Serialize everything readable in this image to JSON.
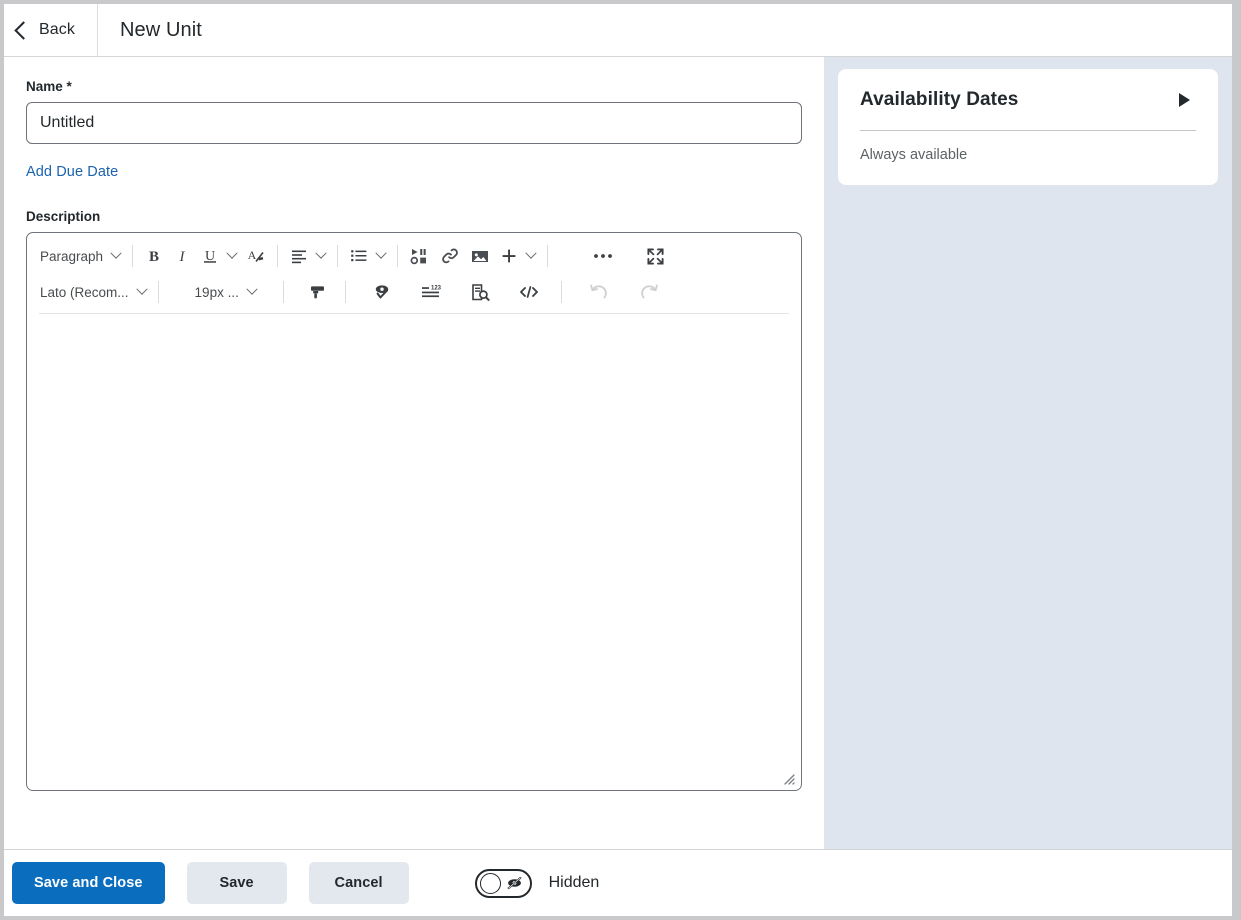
{
  "header": {
    "back_label": "Back",
    "back_icon": "chevron-left-icon",
    "title": "New Unit"
  },
  "form": {
    "name_label": "Name",
    "name_required_marker": "*",
    "name_value": "Untitled",
    "name_placeholder": "Untitled",
    "add_due_date_label": "Add Due Date",
    "description_label": "Description"
  },
  "editor": {
    "toolbar_row1": [
      {
        "name": "paragraph-style-select",
        "label": "Paragraph",
        "icon": "chevron-down-icon",
        "type": "dropdown"
      },
      {
        "name": "bold-button",
        "label": "B",
        "icon": "bold-icon",
        "type": "icon"
      },
      {
        "name": "italic-button",
        "label": "I",
        "icon": "italic-icon",
        "type": "icon"
      },
      {
        "name": "underline-button",
        "label": "U",
        "icon": "underline-icon",
        "type": "icon-dropdown"
      },
      {
        "name": "clear-formatting-button",
        "label": "",
        "icon": "clear-formatting-icon",
        "type": "icon"
      },
      {
        "name": "align-button",
        "label": "",
        "icon": "align-left-icon",
        "type": "icon-dropdown"
      },
      {
        "name": "list-button",
        "label": "",
        "icon": "bulleted-list-icon",
        "type": "icon-dropdown"
      },
      {
        "name": "insert-media-button",
        "label": "",
        "icon": "media-icon",
        "type": "icon"
      },
      {
        "name": "insert-link-button",
        "label": "",
        "icon": "link-icon",
        "type": "icon"
      },
      {
        "name": "insert-image-button",
        "label": "",
        "icon": "image-icon",
        "type": "icon"
      },
      {
        "name": "insert-more-button",
        "label": "",
        "icon": "plus-icon",
        "type": "icon-dropdown"
      },
      {
        "name": "overflow-menu-button",
        "label": "",
        "icon": "ellipsis-icon",
        "type": "icon"
      },
      {
        "name": "fullscreen-button",
        "label": "",
        "icon": "expand-icon",
        "type": "icon"
      }
    ],
    "toolbar_row2": [
      {
        "name": "font-family-select",
        "label": "Lato (Recom...",
        "icon": "chevron-down-icon",
        "type": "dropdown"
      },
      {
        "name": "font-size-select",
        "label": "19px ...",
        "icon": "chevron-down-icon",
        "type": "dropdown"
      },
      {
        "name": "format-painter-button",
        "label": "",
        "icon": "format-painter-icon",
        "type": "icon"
      },
      {
        "name": "accessibility-checker-button",
        "label": "",
        "icon": "accessibility-check-icon",
        "type": "icon"
      },
      {
        "name": "equation-button",
        "label": "",
        "icon": "equation-icon",
        "type": "icon"
      },
      {
        "name": "word-count-button",
        "label": "",
        "icon": "word-count-icon",
        "type": "icon"
      },
      {
        "name": "html-source-button",
        "label": "",
        "icon": "code-icon",
        "type": "icon"
      },
      {
        "name": "undo-button",
        "label": "",
        "icon": "undo-icon",
        "type": "icon",
        "disabled": true
      },
      {
        "name": "redo-button",
        "label": "",
        "icon": "redo-icon",
        "type": "icon",
        "disabled": true
      }
    ],
    "content": "",
    "resize_grip_icon": "resize-grip-icon"
  },
  "availability": {
    "title": "Availability Dates",
    "expand_icon": "triangle-right-icon",
    "status": "Always available"
  },
  "footer": {
    "save_and_close_label": "Save and Close",
    "save_label": "Save",
    "cancel_label": "Cancel",
    "visibility_toggle_label": "Hidden",
    "visibility_toggle_icon": "eye-hidden-icon",
    "visibility_toggle_state": "off"
  },
  "colors": {
    "primary_blue": "#0b6dbd",
    "link_blue": "#1a62ad",
    "panel_background": "#dfe5ee",
    "secondary_button": "#e3e8ee",
    "text": "#23282c",
    "muted_text": "#5d6265",
    "border": "#6e7479"
  }
}
